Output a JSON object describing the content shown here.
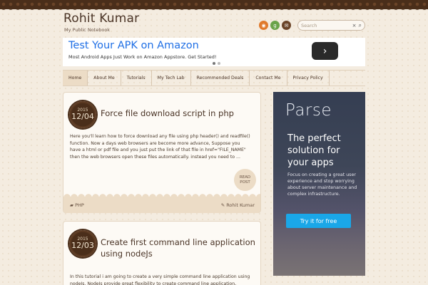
{
  "site": {
    "title": "Rohit Kumar",
    "description": "My Public Notebook"
  },
  "social": [
    {
      "name": "rss-icon",
      "glyph": "◉"
    },
    {
      "name": "google-plus-icon",
      "glyph": "g"
    },
    {
      "name": "email-icon",
      "glyph": "✉"
    }
  ],
  "search": {
    "placeholder": "Search",
    "clear": "×",
    "icon": "⌕"
  },
  "top_ad": {
    "title": "Test Your APK on Amazon",
    "subtitle": "Most Android Apps Just Work on Amazon Appstore. Get Started!",
    "arrow": "›"
  },
  "nav": {
    "items": [
      "Home",
      "About Me",
      "Tutorials",
      "My Tech Lab",
      "Recommended Deals",
      "Contact Me",
      "Privacy Policy"
    ]
  },
  "posts": [
    {
      "year": "2015",
      "monthday": "12/04",
      "title": "Force file download script in php",
      "excerpt": "Here you'll learn how to force download any file using php header() and readfile() function. Now a days web browsers are become more advance, Suppose you have a html or pdf file and you just put the link of that file in href=\"FILE_NAME\" then the web browsers open these files automatically. instead you need to ...",
      "read_label": "READ POST",
      "category": "PHP",
      "author": "Rohit Kumar"
    },
    {
      "year": "2015",
      "monthday": "12/03",
      "title": "Create first command line application using nodeJs",
      "excerpt": "In this tutorial i am going to create a very simple command line application using nodeJs. NodeJs provide great flexibility to create command line application, express-"
    }
  ],
  "side_ad": {
    "brand": "Parse",
    "headline": "The perfect solution for your apps",
    "body": "Focus on creating a great user experience and stop worrying about server maintenance and complex infrastructure.",
    "button": "Try it for free"
  },
  "colors": {
    "accent": "#4a2e1a",
    "ad_blue": "#1f6fe5",
    "cta": "#1aa7e8"
  }
}
